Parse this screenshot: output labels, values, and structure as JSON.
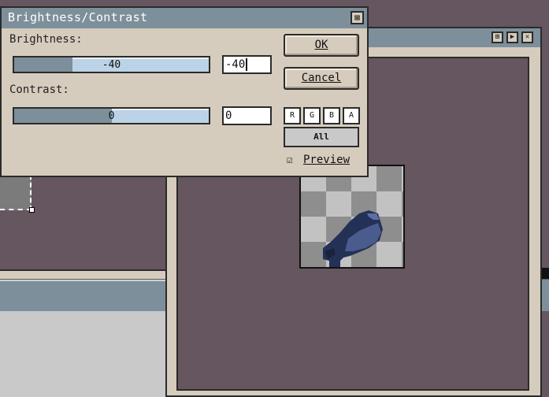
{
  "dialog": {
    "title": "Brightness/Contrast",
    "close_glyph": "⊠",
    "brightness": {
      "label": "Brightness:",
      "slider_text": "-40",
      "value": "-40",
      "fill_fraction": 0.3
    },
    "contrast": {
      "label": "Contrast:",
      "slider_text": "0",
      "value": "0",
      "fill_fraction": 0.5
    },
    "ok_label": "OK",
    "cancel_label": "Cancel",
    "channels": [
      "R",
      "G",
      "B",
      "A"
    ],
    "all_label": "All",
    "preview": {
      "checked": true,
      "check_glyph": "☑",
      "label": "Preview"
    }
  },
  "image_window": {
    "buttons": [
      "⊞",
      "▶",
      "✕"
    ]
  },
  "colors": {
    "titlebar": "#7d8f9b",
    "panel": "#d6ccbd",
    "canvas_bg": "#65565f",
    "slider_track": "#bcd2e6"
  }
}
